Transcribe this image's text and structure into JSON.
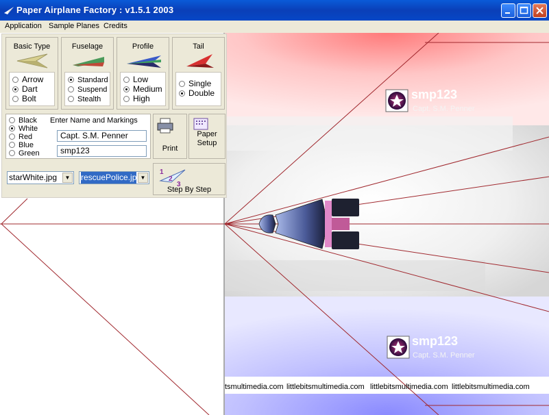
{
  "window": {
    "title": "Paper Airplane Factory : v1.5.1 2003"
  },
  "menu": [
    "Application",
    "Sample Planes",
    "Credits"
  ],
  "groups": {
    "basic_type": {
      "title": "Basic Type",
      "options": [
        "Arrow",
        "Dart",
        "Bolt"
      ],
      "selected": "Dart"
    },
    "fuselage": {
      "title": "Fuselage",
      "options": [
        "Standard",
        "Suspend",
        "Stealth"
      ],
      "selected": "Standard"
    },
    "profile": {
      "title": "Profile",
      "options": [
        "Low",
        "Medium",
        "High"
      ],
      "selected": "Medium"
    },
    "tail": {
      "title": "Tail",
      "options": [
        "Single",
        "Double"
      ],
      "selected": "Double"
    }
  },
  "colors": {
    "options": [
      "Black",
      "White",
      "Red",
      "Blue",
      "Green"
    ],
    "selected": "White"
  },
  "markings": {
    "label": "Enter Name and Markings",
    "name": "Capt. S.M. Penner",
    "code": "smp123"
  },
  "buttons": {
    "print": "Print",
    "paper_setup_1": "Paper",
    "paper_setup_2": "Setup",
    "step": "Step By Step"
  },
  "selects": {
    "texture": "starWhite.jpg",
    "decal": "rescuePolice.jpg"
  },
  "watermark": {
    "name": "smp123",
    "sub": "Capt. S.M. Penner"
  },
  "footer": [
    "tsmultimedia.com",
    "littlebitsmultimedia.com",
    "littlebitsmultimedia.com",
    "littlebitsmultimedia.com"
  ],
  "theme": {
    "titlebar": "#0a4fd0",
    "panel": "#ece9d8",
    "fold_line": "#a0282e"
  }
}
